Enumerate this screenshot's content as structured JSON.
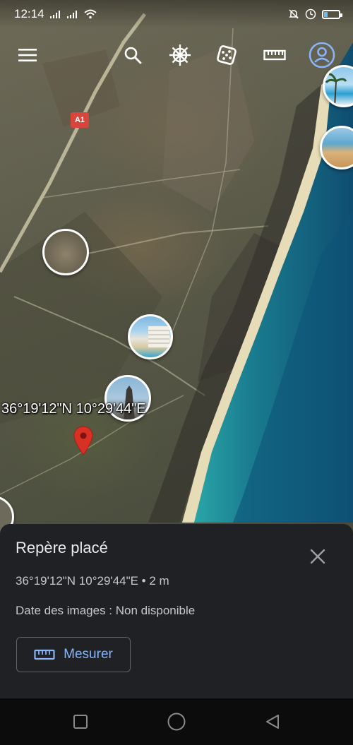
{
  "status_bar": {
    "time": "12:14"
  },
  "map": {
    "coordinate_label": "36°19'12\"N 10°29'44\"E",
    "road_badge": "A1",
    "colors": {
      "sea": "#1a7d90",
      "beach": "#e7dcb8",
      "pin": "#d93025"
    }
  },
  "toolbar": {
    "icons": [
      "menu-icon",
      "search-icon",
      "voyager-wheel-icon",
      "dice-icon",
      "ruler-icon",
      "account-icon"
    ]
  },
  "panel": {
    "title": "Repère placé",
    "coordinates": "36°19'12\"N 10°29'44\"E • 2 m",
    "image_date": "Date des images : Non disponible",
    "measure_label": "Mesurer",
    "accent_color": "#8ab4f8"
  },
  "nav_bar": {
    "icons": [
      "recent-apps-icon",
      "home-icon",
      "back-icon"
    ]
  }
}
